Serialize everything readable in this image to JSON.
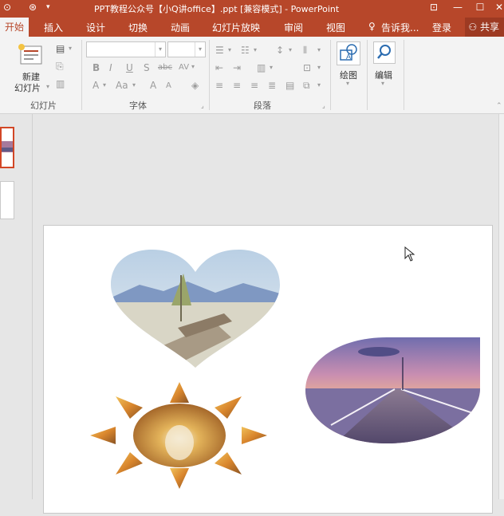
{
  "window": {
    "title": "PPT教程公众号【小Q讲office】.ppt [兼容模式] - PowerPoint",
    "controls": {
      "ribbon_display": "⊡",
      "minimize": "—",
      "maximize": "☐",
      "close": "✕"
    }
  },
  "tabs": [
    {
      "label": "开始",
      "active": true
    },
    {
      "label": "插入"
    },
    {
      "label": "设计"
    },
    {
      "label": "切换"
    },
    {
      "label": "动画"
    },
    {
      "label": "幻灯片放映"
    },
    {
      "label": "审阅"
    },
    {
      "label": "视图"
    }
  ],
  "tell_me": "告诉我...",
  "login": "登录",
  "share": "共享",
  "ribbon": {
    "slides_group": {
      "new_slide_line1": "新建",
      "new_slide_line2": "幻灯片",
      "label": "幻灯片"
    },
    "font_group": {
      "label": "字体",
      "font_name": "",
      "font_size": "",
      "bold": "B",
      "italic": "I",
      "underline": "U",
      "shadow": "S",
      "strike": "abc",
      "spacing": "AV",
      "font_color": "A",
      "case": "Aa",
      "grow": "A",
      "shrink": "A"
    },
    "paragraph_group": {
      "label": "段落"
    },
    "drawing": {
      "label": "绘图"
    },
    "editing": {
      "label": "编辑"
    }
  },
  "colors": {
    "accent": "#b7472a",
    "accent_dark": "#9d3a22",
    "ribbon_bg": "#f3f3f3",
    "workspace": "#e6e6e6"
  }
}
